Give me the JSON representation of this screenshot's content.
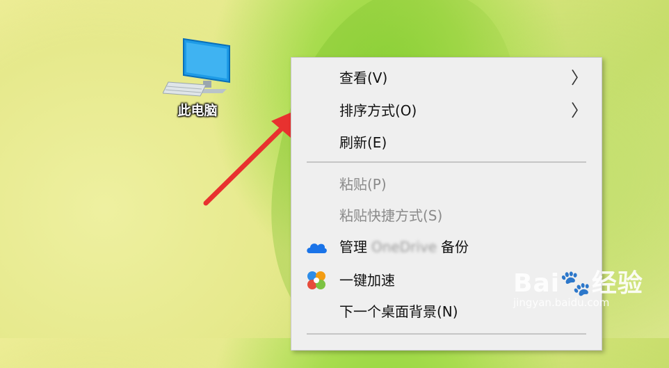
{
  "desktop": {
    "icon_label": "此电脑"
  },
  "menu": {
    "items": [
      {
        "label": "查看(V)",
        "submenu": true,
        "disabled": false
      },
      {
        "label": "排序方式(O)",
        "submenu": true,
        "disabled": false
      },
      {
        "label": "刷新(E)",
        "submenu": false,
        "disabled": false
      },
      {
        "label": "粘贴(P)",
        "submenu": false,
        "disabled": true
      },
      {
        "label": "粘贴快捷方式(S)",
        "submenu": false,
        "disabled": true
      },
      {
        "label_prefix": "管理",
        "label_blurred": "OneDrive",
        "label_suffix": "备份",
        "icon": "onedrive-cloud-icon"
      },
      {
        "label": "一键加速",
        "icon": "speedup-icon"
      },
      {
        "label": "下一个桌面背景(N)",
        "submenu": false,
        "disabled": false
      }
    ],
    "chevron": "〉"
  },
  "watermark": {
    "logo": "Bai🐾经验",
    "url": "jingyan.baidu.com"
  },
  "colors": {
    "arrow": "#e8312f",
    "onedrive": "#1a73e8"
  }
}
